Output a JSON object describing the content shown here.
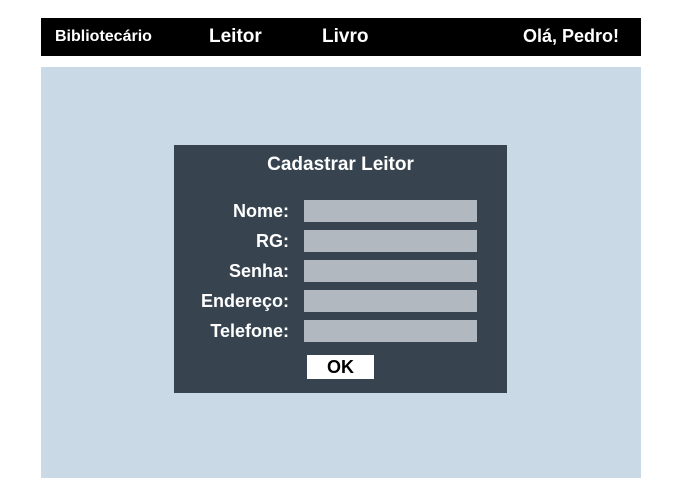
{
  "nav": {
    "items": [
      {
        "label": "Bibliotecário"
      },
      {
        "label": "Leitor"
      },
      {
        "label": "Livro"
      }
    ],
    "greeting": "Olá, Pedro!"
  },
  "dialog": {
    "title": "Cadastrar Leitor",
    "fields": [
      {
        "label": "Nome:",
        "value": ""
      },
      {
        "label": "RG:",
        "value": ""
      },
      {
        "label": "Senha:",
        "value": ""
      },
      {
        "label": "Endereço:",
        "value": ""
      },
      {
        "label": "Telefone:",
        "value": ""
      }
    ],
    "ok_label": "OK"
  },
  "colors": {
    "navbar": "#000000",
    "content_background": "#c9d9e6",
    "dialog_background": "#374450",
    "input_background": "#b1b8bf",
    "button_background": "#ffffff"
  }
}
